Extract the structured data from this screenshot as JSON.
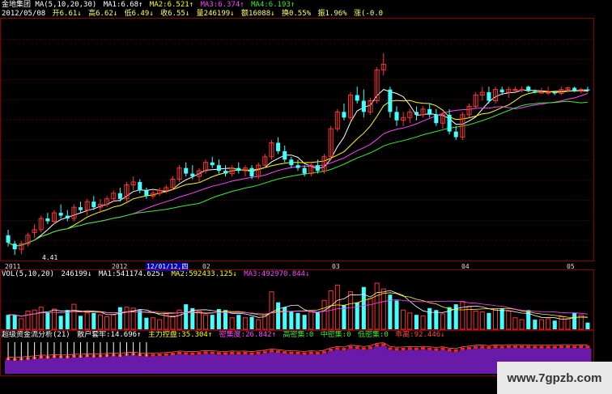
{
  "header": {
    "indicator_title": "金地集团 MA(5,10,20,30)",
    "ma1": "MA1:6.68↑",
    "ma2": "MA2:6.521↑",
    "ma3": "MA3:6.374↑",
    "ma4": "MA4:6.193↑",
    "date": "2012/05/08",
    "open": "开6.61↓",
    "high": "高6.62↓",
    "low": "低6.49↓",
    "close": "收6.55↓",
    "volume": "量246199↓",
    "amount": "额16088↓",
    "turnover": "换0.55%",
    "amplitude": "振1.96%",
    "extra": "涨(-0.0"
  },
  "vol_header": {
    "title": "VOL(5,10,20)",
    "value": "246199↓",
    "ma1": "MA1:541174.625↓",
    "ma2": "MA2:592433.125↓",
    "ma3": "MA3:492970.844↓"
  },
  "ind_header": {
    "title": "超级资金流分析(21)",
    "a": "散户套牢:14.696↑",
    "b": "主力控盘:35.304↑",
    "c": "密集度:26.842↑",
    "d": "高密集:0",
    "e": "中密集:0",
    "f": "低密集:0",
    "g": "乖离:92.446↓"
  },
  "x_axis": {
    "l2011": "2011",
    "l2012": "2012",
    "lsel": "12/01/12,四",
    "l02": "02",
    "l03": "03",
    "l04": "04",
    "l05": "05"
  },
  "annotation": "4.41",
  "watermark": "www.7gpzb.com",
  "colors": {
    "up": "#ff3333",
    "down": "#44ffff",
    "ma1": "#ffffff",
    "ma2": "#ffff00",
    "ma3": "#ff44ff",
    "ma4": "#33ee33",
    "grid": "#990000"
  },
  "chart_data": {
    "type": "candlestick",
    "candles": [
      {
        "o": 4.75,
        "h": 4.85,
        "l": 4.55,
        "c": 4.62,
        "v": 30
      },
      {
        "o": 4.6,
        "h": 4.65,
        "l": 4.4,
        "c": 4.5,
        "v": 30
      },
      {
        "o": 4.5,
        "h": 4.65,
        "l": 4.41,
        "c": 4.6,
        "v": 22
      },
      {
        "o": 4.6,
        "h": 4.8,
        "l": 4.55,
        "c": 4.75,
        "v": 38
      },
      {
        "o": 4.8,
        "h": 4.95,
        "l": 4.7,
        "c": 4.85,
        "v": 40
      },
      {
        "o": 4.85,
        "h": 5.1,
        "l": 4.8,
        "c": 5.05,
        "v": 46
      },
      {
        "o": 5.05,
        "h": 5.15,
        "l": 4.95,
        "c": 5.0,
        "v": 35
      },
      {
        "o": 5.0,
        "h": 5.2,
        "l": 4.95,
        "c": 5.15,
        "v": 42
      },
      {
        "o": 5.15,
        "h": 5.3,
        "l": 5.05,
        "c": 5.1,
        "v": 28
      },
      {
        "o": 5.1,
        "h": 5.2,
        "l": 5.0,
        "c": 5.05,
        "v": 40
      },
      {
        "o": 5.05,
        "h": 5.3,
        "l": 5.0,
        "c": 5.25,
        "v": 52
      },
      {
        "o": 5.25,
        "h": 5.35,
        "l": 5.15,
        "c": 5.2,
        "v": 28
      },
      {
        "o": 5.2,
        "h": 5.4,
        "l": 5.1,
        "c": 5.35,
        "v": 34
      },
      {
        "o": 5.35,
        "h": 5.45,
        "l": 5.2,
        "c": 5.25,
        "v": 34
      },
      {
        "o": 5.25,
        "h": 5.4,
        "l": 5.15,
        "c": 5.3,
        "v": 30
      },
      {
        "o": 5.3,
        "h": 5.45,
        "l": 5.25,
        "c": 5.4,
        "v": 26
      },
      {
        "o": 5.4,
        "h": 5.55,
        "l": 5.35,
        "c": 5.5,
        "v": 30
      },
      {
        "o": 5.5,
        "h": 5.6,
        "l": 5.35,
        "c": 5.4,
        "v": 46
      },
      {
        "o": 5.4,
        "h": 5.7,
        "l": 5.35,
        "c": 5.65,
        "v": 46
      },
      {
        "o": 5.65,
        "h": 5.8,
        "l": 5.55,
        "c": 5.7,
        "v": 44
      },
      {
        "o": 5.7,
        "h": 5.75,
        "l": 5.5,
        "c": 5.55,
        "v": 40
      },
      {
        "o": 5.55,
        "h": 5.6,
        "l": 5.4,
        "c": 5.45,
        "v": 24
      },
      {
        "o": 5.45,
        "h": 5.55,
        "l": 5.4,
        "c": 5.5,
        "v": 24
      },
      {
        "o": 5.5,
        "h": 5.6,
        "l": 5.45,
        "c": 5.55,
        "v": 20
      },
      {
        "o": 5.55,
        "h": 5.65,
        "l": 5.5,
        "c": 5.6,
        "v": 32
      },
      {
        "o": 5.6,
        "h": 5.8,
        "l": 5.55,
        "c": 5.75,
        "v": 28
      },
      {
        "o": 5.75,
        "h": 6.0,
        "l": 5.7,
        "c": 5.95,
        "v": 40
      },
      {
        "o": 5.95,
        "h": 6.05,
        "l": 5.8,
        "c": 5.85,
        "v": 52
      },
      {
        "o": 5.85,
        "h": 6.0,
        "l": 5.75,
        "c": 5.8,
        "v": 44
      },
      {
        "o": 5.8,
        "h": 5.95,
        "l": 5.7,
        "c": 5.9,
        "v": 38
      },
      {
        "o": 5.9,
        "h": 6.1,
        "l": 5.85,
        "c": 6.05,
        "v": 30
      },
      {
        "o": 6.05,
        "h": 6.15,
        "l": 5.95,
        "c": 6.0,
        "v": 30
      },
      {
        "o": 6.0,
        "h": 6.1,
        "l": 5.85,
        "c": 5.9,
        "v": 42
      },
      {
        "o": 5.9,
        "h": 6.0,
        "l": 5.8,
        "c": 5.85,
        "v": 40
      },
      {
        "o": 5.85,
        "h": 6.0,
        "l": 5.8,
        "c": 5.95,
        "v": 24
      },
      {
        "o": 5.95,
        "h": 6.05,
        "l": 5.85,
        "c": 5.9,
        "v": 30
      },
      {
        "o": 5.9,
        "h": 6.0,
        "l": 5.8,
        "c": 5.95,
        "v": 24
      },
      {
        "o": 5.95,
        "h": 6.0,
        "l": 5.75,
        "c": 5.8,
        "v": 26
      },
      {
        "o": 5.8,
        "h": 6.05,
        "l": 5.75,
        "c": 6.0,
        "v": 20
      },
      {
        "o": 6.0,
        "h": 6.2,
        "l": 5.95,
        "c": 6.15,
        "v": 30
      },
      {
        "o": 6.15,
        "h": 6.45,
        "l": 6.1,
        "c": 6.4,
        "v": 78
      },
      {
        "o": 6.4,
        "h": 6.5,
        "l": 6.2,
        "c": 6.25,
        "v": 56
      },
      {
        "o": 6.25,
        "h": 6.35,
        "l": 6.05,
        "c": 6.1,
        "v": 46
      },
      {
        "o": 6.1,
        "h": 6.15,
        "l": 5.95,
        "c": 6.0,
        "v": 38
      },
      {
        "o": 6.0,
        "h": 6.1,
        "l": 5.9,
        "c": 5.95,
        "v": 34
      },
      {
        "o": 5.95,
        "h": 6.0,
        "l": 5.8,
        "c": 5.85,
        "v": 30
      },
      {
        "o": 5.85,
        "h": 6.05,
        "l": 5.8,
        "c": 6.0,
        "v": 36
      },
      {
        "o": 6.0,
        "h": 6.1,
        "l": 5.85,
        "c": 5.9,
        "v": 34
      },
      {
        "o": 5.9,
        "h": 6.2,
        "l": 5.85,
        "c": 6.15,
        "v": 60
      },
      {
        "o": 6.15,
        "h": 6.7,
        "l": 6.1,
        "c": 6.65,
        "v": 80
      },
      {
        "o": 6.65,
        "h": 7.0,
        "l": 6.6,
        "c": 6.95,
        "v": 92
      },
      {
        "o": 6.95,
        "h": 7.1,
        "l": 6.8,
        "c": 6.85,
        "v": 50
      },
      {
        "o": 6.85,
        "h": 7.3,
        "l": 6.8,
        "c": 7.25,
        "v": 78
      },
      {
        "o": 7.25,
        "h": 7.4,
        "l": 7.1,
        "c": 7.15,
        "v": 56
      },
      {
        "o": 7.15,
        "h": 7.35,
        "l": 6.85,
        "c": 6.95,
        "v": 88
      },
      {
        "o": 6.95,
        "h": 7.2,
        "l": 6.9,
        "c": 7.15,
        "v": 64
      },
      {
        "o": 7.15,
        "h": 7.75,
        "l": 7.1,
        "c": 7.7,
        "v": 96
      },
      {
        "o": 7.7,
        "h": 8.0,
        "l": 7.6,
        "c": 7.8,
        "v": 84
      },
      {
        "o": 7.35,
        "h": 7.4,
        "l": 6.85,
        "c": 6.95,
        "v": 72
      },
      {
        "o": 6.95,
        "h": 7.05,
        "l": 6.7,
        "c": 6.8,
        "v": 60
      },
      {
        "o": 6.8,
        "h": 6.95,
        "l": 6.7,
        "c": 6.85,
        "v": 40
      },
      {
        "o": 6.85,
        "h": 7.0,
        "l": 6.75,
        "c": 6.95,
        "v": 34
      },
      {
        "o": 6.95,
        "h": 7.05,
        "l": 6.8,
        "c": 6.9,
        "v": 30
      },
      {
        "o": 6.9,
        "h": 7.05,
        "l": 6.85,
        "c": 7.0,
        "v": 28
      },
      {
        "o": 7.0,
        "h": 7.1,
        "l": 6.85,
        "c": 6.9,
        "v": 44
      },
      {
        "o": 6.9,
        "h": 7.0,
        "l": 6.7,
        "c": 6.75,
        "v": 40
      },
      {
        "o": 6.75,
        "h": 6.95,
        "l": 6.65,
        "c": 6.9,
        "v": 32
      },
      {
        "o": 6.9,
        "h": 7.0,
        "l": 6.55,
        "c": 6.6,
        "v": 46
      },
      {
        "o": 6.6,
        "h": 6.7,
        "l": 6.45,
        "c": 6.5,
        "v": 52
      },
      {
        "o": 6.5,
        "h": 6.95,
        "l": 6.45,
        "c": 6.9,
        "v": 58
      },
      {
        "o": 6.9,
        "h": 7.1,
        "l": 6.85,
        "c": 7.05,
        "v": 48
      },
      {
        "o": 7.05,
        "h": 7.3,
        "l": 7.0,
        "c": 7.25,
        "v": 38
      },
      {
        "o": 7.25,
        "h": 7.4,
        "l": 7.15,
        "c": 7.3,
        "v": 36
      },
      {
        "o": 7.3,
        "h": 7.4,
        "l": 7.1,
        "c": 7.15,
        "v": 34
      },
      {
        "o": 7.15,
        "h": 7.4,
        "l": 7.1,
        "c": 7.35,
        "v": 42
      },
      {
        "o": 7.35,
        "h": 7.4,
        "l": 7.25,
        "c": 7.3,
        "v": 44
      },
      {
        "o": 7.3,
        "h": 7.4,
        "l": 7.2,
        "c": 7.35,
        "v": 38
      },
      {
        "o": 7.35,
        "h": 7.4,
        "l": 7.3,
        "c": 7.35,
        "v": 24
      },
      {
        "o": 7.35,
        "h": 7.4,
        "l": 7.3,
        "c": 7.35,
        "v": 20
      },
      {
        "o": 7.4,
        "h": 7.42,
        "l": 7.3,
        "c": 7.32,
        "v": 40
      },
      {
        "o": 7.32,
        "h": 7.35,
        "l": 7.28,
        "c": 7.3,
        "v": 20
      },
      {
        "o": 7.3,
        "h": 7.38,
        "l": 7.28,
        "c": 7.3,
        "v": 20
      },
      {
        "o": 7.3,
        "h": 7.4,
        "l": 7.25,
        "c": 7.3,
        "v": 22
      },
      {
        "o": 7.3,
        "h": 7.32,
        "l": 7.25,
        "c": 7.28,
        "v": 18
      },
      {
        "o": 7.28,
        "h": 7.4,
        "l": 7.25,
        "c": 7.35,
        "v": 26
      },
      {
        "o": 7.35,
        "h": 7.4,
        "l": 7.3,
        "c": 7.38,
        "v": 22
      },
      {
        "o": 7.38,
        "h": 7.4,
        "l": 7.3,
        "c": 7.32,
        "v": 34
      },
      {
        "o": 7.32,
        "h": 7.38,
        "l": 7.28,
        "c": 7.35,
        "v": 30
      },
      {
        "o": 7.35,
        "h": 7.4,
        "l": 7.3,
        "c": 7.33,
        "v": 14
      }
    ],
    "price_range": [
      4.3,
      8.6
    ],
    "legend": [
      "MA1",
      "MA2",
      "MA3",
      "MA4"
    ]
  }
}
